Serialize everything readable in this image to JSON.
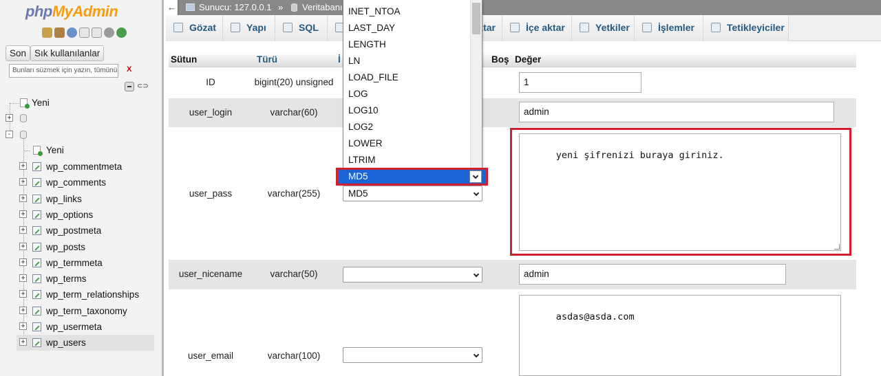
{
  "nav": {
    "logo_php": "php",
    "logo_myadmin": "MyAdmin",
    "icons": [
      "home-icon",
      "sql-window-icon",
      "help-icon",
      "docs-icon",
      "copy-icon",
      "settings-icon",
      "reload-icon"
    ],
    "recent_button": "Son",
    "favorites_button": "Sık kullanılanlar",
    "filter_placeholder": "Bunları süzmek için yazın, tümünü ar",
    "filter_clear": "X",
    "new_top": "Yeni",
    "new_db": "Yeni",
    "tables": [
      "wp_commentmeta",
      "wp_comments",
      "wp_links",
      "wp_options",
      "wp_postmeta",
      "wp_posts",
      "wp_termmeta",
      "wp_terms",
      "wp_term_relationships",
      "wp_term_taxonomy",
      "wp_usermeta",
      "wp_users"
    ]
  },
  "topbar": {
    "back": "←",
    "server": "Sunucu: 127.0.0.1",
    "separator": "»",
    "database": "Veritabanı"
  },
  "tabs": [
    {
      "label": "Gözat",
      "icon": "browse-icon"
    },
    {
      "label": "Yapı",
      "icon": "structure-icon"
    },
    {
      "label": "SQL",
      "icon": "sql-icon"
    },
    {
      "label": "ktar",
      "icon": "search-icon"
    },
    {
      "label": "İçe aktar",
      "icon": "import-icon"
    },
    {
      "label": "Yetkiler",
      "icon": "privileges-icon"
    },
    {
      "label": "İşlemler",
      "icon": "operations-icon"
    },
    {
      "label": "Tetikleyiciler",
      "icon": "triggers-icon"
    }
  ],
  "table_header": {
    "column": "Sütun",
    "type": "Türü",
    "function": "İ",
    "null": "Boş",
    "value": "Değer"
  },
  "rows": [
    {
      "name": "ID",
      "type": "bigint(20) unsigned",
      "value": "1"
    },
    {
      "name": "user_login",
      "type": "varchar(60)",
      "value": "admin"
    },
    {
      "name": "user_pass",
      "type": "varchar(255)",
      "function": "MD5",
      "value": "yeni şifrenizi buraya giriniz."
    },
    {
      "name": "user_nicename",
      "type": "varchar(50)",
      "function": "",
      "value": "admin"
    },
    {
      "name": "user_email",
      "type": "varchar(100)",
      "function": "",
      "value": "asdas@asda.com"
    }
  ],
  "dropdown": {
    "options": [
      "INET_NTOA",
      "LAST_DAY",
      "LENGTH",
      "LN",
      "LOAD_FILE",
      "LOG",
      "LOG10",
      "LOG2",
      "LOWER",
      "LTRIM"
    ],
    "selected": "MD5"
  },
  "colors": {
    "highlight": "#d0202e",
    "selection": "#1a64d6",
    "link": "#235a81"
  }
}
